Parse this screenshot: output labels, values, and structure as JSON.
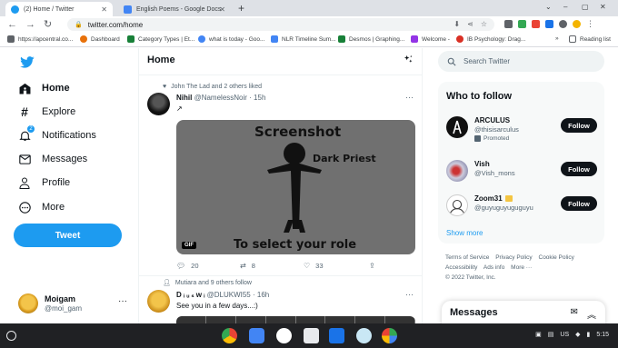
{
  "browser": {
    "tabs": [
      {
        "label": "(2) Home / Twitter",
        "active": true
      },
      {
        "label": "English Poems - Google Docs",
        "active": false
      }
    ],
    "url": "twitter.com/home",
    "bookmarks": [
      "https://apcentral.co...",
      "Dashboard",
      "Category Types | Et...",
      "what is today - Goo...",
      "NLR Timeline Sum...",
      "Desmos | Graphing...",
      "Welcome -",
      "IB Psychology: Drag..."
    ],
    "bookmarks_overflow": "»",
    "reading_list": "Reading list"
  },
  "sidebar": {
    "items": [
      {
        "label": "Home",
        "icon": "home-icon"
      },
      {
        "label": "Explore",
        "icon": "hashtag-icon"
      },
      {
        "label": "Notifications",
        "icon": "bell-icon",
        "badge": "2"
      },
      {
        "label": "Messages",
        "icon": "mail-icon"
      },
      {
        "label": "Profile",
        "icon": "person-icon"
      },
      {
        "label": "More",
        "icon": "more-circle-icon"
      }
    ],
    "tweet_button": "Tweet",
    "account": {
      "name": "Moigam",
      "handle": "@moi_gam",
      "more": "···"
    }
  },
  "main": {
    "title": "Home",
    "tweet1": {
      "social": "John The Lad and 2 others liked",
      "name": "Nihil",
      "handle": "@NamelessNoir",
      "time": "· 15h",
      "text": "↗",
      "media": {
        "line1": "Screenshot",
        "line2": "Dark Priest",
        "line3": "To select your role",
        "gif": "GIF"
      },
      "replies": "20",
      "retweets": "8",
      "likes": "33"
    },
    "tweet2": {
      "social": "Mutiara and 9 others follow",
      "name": "D ᵢ ᵤ ₛ w ᵢ",
      "handle": "@DLUKWI55",
      "time": "· 16h",
      "text": "See you in a few days...:)"
    }
  },
  "right": {
    "search_placeholder": "Search Twitter",
    "who_to_follow": "Who to follow",
    "follow_label": "Follow",
    "suggestions": [
      {
        "name": "ARCULUS",
        "handle": "@thisisarculus",
        "promoted": "Promoted"
      },
      {
        "name": "Vish",
        "handle": "@Vish_mons",
        "promoted": ""
      },
      {
        "name": "Zoom31",
        "handle": "@guyuguyuguguyu",
        "promoted": ""
      }
    ],
    "show_more": "Show more",
    "footer": [
      "Terms of Service",
      "Privacy Policy",
      "Cookie Policy",
      "Accessibility",
      "Ads info",
      "More ···",
      "© 2022 Twitter, Inc."
    ],
    "messages": "Messages"
  },
  "shelf": {
    "tray": {
      "locale": "US",
      "time": "5:15"
    }
  },
  "colors": {
    "twitter_blue": "#1d9bf0",
    "text": "#0f1419",
    "muted": "#536471"
  }
}
